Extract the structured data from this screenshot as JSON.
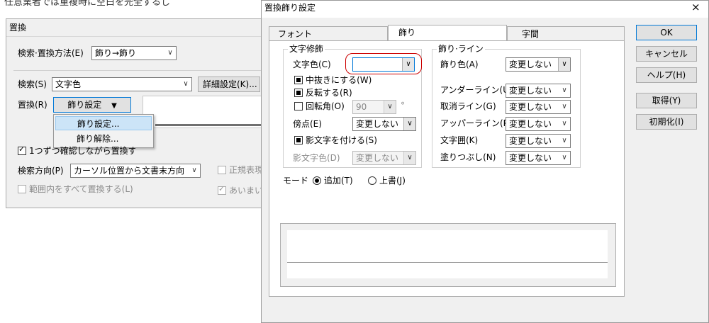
{
  "background": {
    "top_text": "任意業者では重複時に空白を完全するし"
  },
  "replace_dialog": {
    "title": "置換",
    "method_label": "検索·置換方法(E)",
    "method_value": "飾り→飾り",
    "search_label": "検索(S)",
    "search_value": "文字色",
    "detail_button": "詳細設定(K)...",
    "replace_label": "置換(R)",
    "replace_button": "飾り設定",
    "menu": [
      "飾り設定...",
      "飾り解除..."
    ],
    "confirm_label": "1つずつ確認しながら置換する(G)",
    "direction_label": "検索方向(P)",
    "direction_value": "カーソル位置から文書末方向",
    "regex_label": "正規表現",
    "range_label": "範囲内をすべて置換する(L)",
    "fuzzy_label": "あいまい"
  },
  "deco_dialog": {
    "title": "置換飾り設定",
    "close": "×",
    "tabs": [
      "フォント",
      "飾り",
      "字間"
    ],
    "left_group": {
      "title": "文字修飾",
      "color_label": "文字色(C)",
      "outline_label": "中抜きにする(W)",
      "invert_label": "反転する(R)",
      "rotate_label": "回転角(O)",
      "rotate_value": "90",
      "degree": "°",
      "emphasis_label": "傍点(E)",
      "emphasis_value": "変更しない",
      "shadow_label": "影文字を付ける(S)",
      "shadow_color_label": "影文字色(D)",
      "shadow_color_value": "変更しない"
    },
    "right_group": {
      "title": "飾り·ライン",
      "rows": [
        {
          "label": "飾り色(A)",
          "value": "変更しない"
        },
        {
          "label": "アンダーライン(U)",
          "value": "変更しない"
        },
        {
          "label": "取消ライン(G)",
          "value": "変更しない"
        },
        {
          "label": "アッパーライン(P)",
          "value": "変更しない"
        },
        {
          "label": "文字囲(K)",
          "value": "変更しない"
        },
        {
          "label": "塗りつぶし(N)",
          "value": "変更しない"
        }
      ]
    },
    "mode": {
      "label": "モード",
      "add": "追加(T)",
      "overwrite": "上書(J)"
    },
    "buttons": {
      "ok": "OK",
      "cancel": "キャンセル",
      "help": "ヘルプ(H)",
      "get": "取得(Y)",
      "reset": "初期化(I)"
    },
    "colors": {
      "highlight": "#cc0000",
      "accent": "#0078d7"
    }
  }
}
